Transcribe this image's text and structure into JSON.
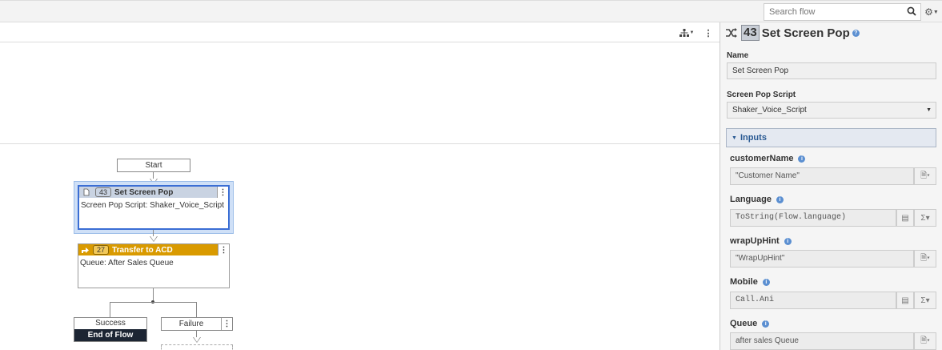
{
  "search": {
    "placeholder": "Search flow"
  },
  "canvas": {
    "start_label": "Start",
    "node1": {
      "number": "43",
      "title": "Set Screen Pop",
      "body": "Screen Pop Script: Shaker_Voice_Script"
    },
    "node2": {
      "number": "27",
      "title": "Transfer to ACD",
      "body": "Queue: After Sales Queue"
    },
    "success_label": "Success",
    "end_label": "End of Flow",
    "failure_label": "Failure"
  },
  "panel": {
    "number": "43",
    "title": "Set Screen Pop",
    "name_label": "Name",
    "name_value": "Set Screen Pop",
    "script_label": "Screen Pop Script",
    "script_value": "Shaker_Voice_Script",
    "inputs_header": "Inputs",
    "inputs": [
      {
        "label": "customerName",
        "value": "\"Customer Name\""
      },
      {
        "label": "Language",
        "value": "ToString(Flow.language)"
      },
      {
        "label": "wrapUpHint",
        "value": "\"WrapUpHint\""
      },
      {
        "label": "Mobile",
        "value": "Call.Ani"
      },
      {
        "label": "Queue",
        "value": "after sales Queue"
      }
    ]
  },
  "colors": {
    "accent": "#2a5a93",
    "transfer_header": "#d99a00",
    "selection": "#cfe0f7"
  }
}
